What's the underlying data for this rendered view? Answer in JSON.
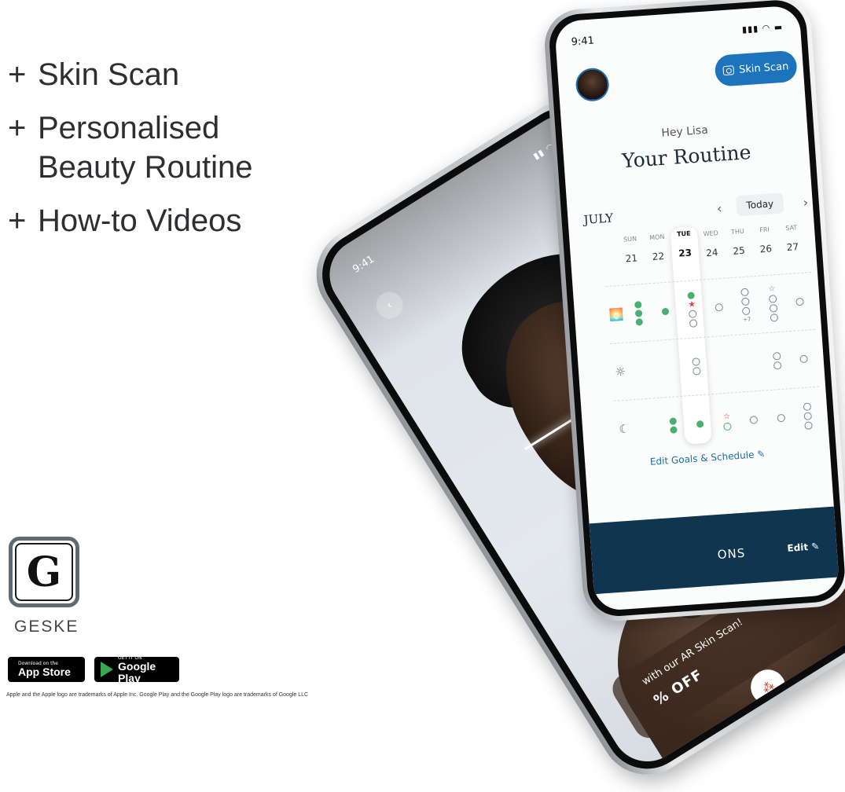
{
  "features": [
    {
      "plus": "+",
      "text": "Skin Scan"
    },
    {
      "plus": "+",
      "text": "Personalised\nBeauty Routine"
    },
    {
      "plus": "+",
      "text": "How-to Videos"
    }
  ],
  "brand": {
    "logo_letter": "G",
    "name": "GESKE"
  },
  "stores": {
    "apple": {
      "small": "Download on the",
      "big": "App Store"
    },
    "google": {
      "small": "GET IT ON",
      "big": "Google Play"
    }
  },
  "disclaimer": "Apple and the Apple logo are trademarks of Apple Inc. Google Play and the Google Play logo are trademarks of Google LLC",
  "routine_phone": {
    "time": "9:41",
    "status": "▮▮▮ ◠ ▬",
    "skin_scan_button": "Skin Scan",
    "greeting": "Hey Lisa",
    "title": "Your Routine",
    "month": "JULY",
    "prev": "‹",
    "next": "›",
    "today_button": "Today",
    "days": [
      {
        "name": "SUN",
        "date": "21"
      },
      {
        "name": "MON",
        "date": "22"
      },
      {
        "name": "TUE",
        "date": "23"
      },
      {
        "name": "WED",
        "date": "24"
      },
      {
        "name": "THU",
        "date": "25"
      },
      {
        "name": "FRI",
        "date": "26"
      },
      {
        "name": "SAT",
        "date": "27"
      }
    ],
    "row_icons": [
      "🌅",
      "☼",
      "☾"
    ],
    "plus_more": "+7",
    "edit_goals": "Edit Goals & Schedule ✎",
    "bottom_text": "ONS",
    "bottom_edit": "Edit ✎",
    "eye_icon": "👁"
  },
  "scan_phone": {
    "time": "9:41",
    "status": "▮▮ ◠ ▬",
    "back": "‹",
    "share": "⤓",
    "offer_text": "with our AR Skin Scan!",
    "offer_big": "% OFF",
    "planet_icon": "🪐",
    "node_icon": "⁂"
  },
  "colors": {
    "accent": "#1e73bd",
    "green": "#4caf72",
    "red_star": "#e2463f",
    "panel": "#0f3550"
  }
}
